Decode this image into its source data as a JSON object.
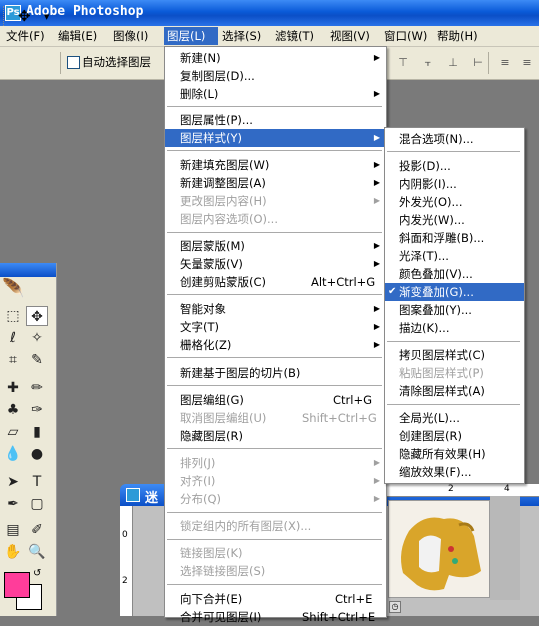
{
  "window": {
    "title": "Adobe Photoshop",
    "app_icon": "Ps"
  },
  "menubar": {
    "items": [
      "文件(F)",
      "编辑(E)",
      "图像(I)",
      "图层(L)",
      "选择(S)",
      "滤镜(T)",
      "视图(V)",
      "窗口(W)",
      "帮助(H)"
    ],
    "active": "图层(L)"
  },
  "optionsbar": {
    "move_icon": "✥",
    "auto_select_label": "自动选择图层"
  },
  "layer_menu": {
    "items": [
      {
        "label": "新建(N)",
        "arrow": "▶"
      },
      {
        "label": "复制图层(D)..."
      },
      {
        "label": "删除(L)",
        "arrow": "▶"
      },
      {
        "label": "图层属性(P)..."
      },
      {
        "label": "图层样式(Y)",
        "arrow": "▶"
      },
      {
        "label": "新建填充图层(W)",
        "arrow": "▶"
      },
      {
        "label": "新建调整图层(A)",
        "arrow": "▶"
      },
      {
        "label": "更改图层内容(H)",
        "arrow": "▶"
      },
      {
        "label": "图层内容选项(O)..."
      },
      {
        "label": "图层蒙版(M)",
        "arrow": "▶"
      },
      {
        "label": "矢量蒙版(V)",
        "arrow": "▶"
      },
      {
        "label": "创建剪贴蒙版(C)",
        "shortcut": "Alt+Ctrl+G"
      },
      {
        "label": "智能对象",
        "arrow": "▶"
      },
      {
        "label": "文字(T)",
        "arrow": "▶"
      },
      {
        "label": "栅格化(Z)",
        "arrow": "▶"
      },
      {
        "label": "新建基于图层的切片(B)"
      },
      {
        "label": "图层编组(G)",
        "shortcut": "Ctrl+G"
      },
      {
        "label": "取消图层编组(U)",
        "shortcut": "Shift+Ctrl+G"
      },
      {
        "label": "隐藏图层(R)"
      },
      {
        "label": "排列(J)",
        "arrow": "▶"
      },
      {
        "label": "对齐(I)",
        "arrow": "▶"
      },
      {
        "label": "分布(Q)",
        "arrow": "▶"
      },
      {
        "label": "锁定组内的所有图层(X)..."
      },
      {
        "label": "链接图层(K)"
      },
      {
        "label": "选择链接图层(S)"
      },
      {
        "label": "向下合并(E)",
        "shortcut": "Ctrl+E"
      },
      {
        "label": "合并可见图层(I)",
        "shortcut": "Shift+Ctrl+E"
      }
    ]
  },
  "style_submenu": {
    "items": [
      {
        "label": "混合选项(N)..."
      },
      {
        "label": "投影(D)..."
      },
      {
        "label": "内阴影(I)..."
      },
      {
        "label": "外发光(O)..."
      },
      {
        "label": "内发光(W)..."
      },
      {
        "label": "斜面和浮雕(B)..."
      },
      {
        "label": "光泽(T)..."
      },
      {
        "label": "颜色叠加(V)..."
      },
      {
        "label": "渐变叠加(G)...",
        "check": "✔"
      },
      {
        "label": "图案叠加(Y)..."
      },
      {
        "label": "描边(K)..."
      },
      {
        "label": "拷贝图层样式(C)"
      },
      {
        "label": "粘贴图层样式(P)"
      },
      {
        "label": "清除图层样式(A)"
      },
      {
        "label": "全局光(L)..."
      },
      {
        "label": "创建图层(R)"
      },
      {
        "label": "隐藏所有效果(H)"
      },
      {
        "label": "缩放效果(F)..."
      }
    ]
  },
  "document": {
    "title_fragment": "迷"
  },
  "rulers": {
    "top": [
      "2",
      "4"
    ],
    "left": [
      "0",
      "2"
    ]
  },
  "colors": {
    "foreground": "#ff3d9a",
    "background": "#ffffff",
    "highlight": "#316ac5",
    "titlebar": "#0b4fc7"
  }
}
